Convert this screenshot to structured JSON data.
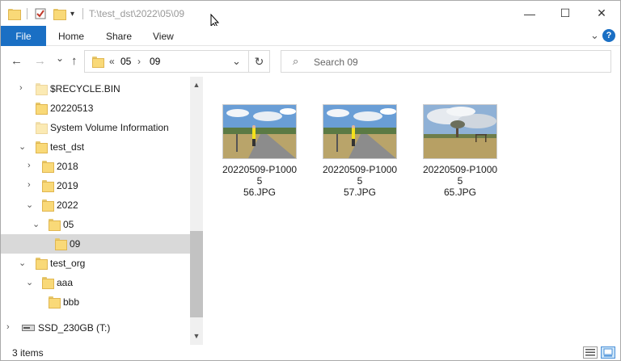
{
  "title_bar": {
    "path_text": "T:\\test_dst\\2022\\05\\09",
    "minimize_glyph": "—",
    "maximize_glyph": "☐",
    "close_glyph": "✕",
    "qa_dropdown_glyph": "▾"
  },
  "ribbon": {
    "tabs": [
      {
        "label": "File"
      },
      {
        "label": "Home"
      },
      {
        "label": "Share"
      },
      {
        "label": "View"
      }
    ],
    "collapse_glyph": "⌄",
    "help_glyph": "?"
  },
  "nav": {
    "back_glyph": "←",
    "forward_glyph": "→",
    "recent_glyph": "⌄",
    "up_glyph": "↑",
    "address": {
      "overflow": "«",
      "crumbs": [
        "05",
        "09"
      ],
      "sep": "›",
      "dropdown_glyph": "⌄"
    },
    "refresh_glyph": "↻",
    "search_placeholder": "Search 09",
    "search_glyph": "⌕"
  },
  "tree": {
    "items": [
      {
        "label": "$RECYCLE.BIN",
        "chevron": "›"
      },
      {
        "label": "20220513",
        "chevron": ""
      },
      {
        "label": "System Volume Information",
        "chevron": ""
      },
      {
        "label": "test_dst",
        "chevron": "⌄"
      },
      {
        "label": "2018",
        "chevron": "›"
      },
      {
        "label": "2019",
        "chevron": "›"
      },
      {
        "label": "2022",
        "chevron": "⌄"
      },
      {
        "label": "05",
        "chevron": "⌄"
      },
      {
        "label": "09",
        "chevron": "",
        "selected": true
      },
      {
        "label": "test_org",
        "chevron": "⌄"
      },
      {
        "label": "aaa",
        "chevron": "⌄"
      },
      {
        "label": "bbb",
        "chevron": ""
      },
      {
        "label": "SSD_230GB (T:)",
        "chevron": "›"
      }
    ],
    "scroll_up": "▲",
    "scroll_down": "▼"
  },
  "files": [
    {
      "name": "20220509-P1000556.JPG",
      "line1": "20220509-P10005",
      "line2": "56.JPG",
      "icon": "photo-road-person"
    },
    {
      "name": "20220509-P1000557.JPG",
      "line1": "20220509-P10005",
      "line2": "57.JPG",
      "icon": "photo-road-person"
    },
    {
      "name": "20220509-P1000565.JPG",
      "line1": "20220509-P10005",
      "line2": "65.JPG",
      "icon": "photo-field-tree"
    }
  ],
  "status": {
    "items_count": "3 items"
  },
  "colors": {
    "accent": "#1a6fc4",
    "selection": "#d9d9d9",
    "folder": "#f9d978"
  }
}
